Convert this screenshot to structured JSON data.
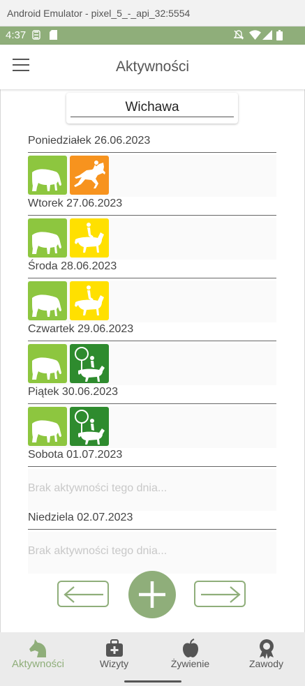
{
  "window": {
    "title": "Android Emulator - pixel_5_-_api_32:5554"
  },
  "status_bar": {
    "time": "4:37"
  },
  "app_bar": {
    "title": "Aktywności"
  },
  "horse_selector": {
    "value": "Wichawa"
  },
  "colors": {
    "accent": "#8fae7a",
    "light_green": "#8dc63f",
    "orange": "#f7931e",
    "yellow": "#ffe000",
    "dark_green": "#2e8b2e"
  },
  "days": [
    {
      "label": "Poniedziałek 26.06.2023",
      "activities": [
        {
          "icon": "grazing-horse-icon",
          "color": "light_green"
        },
        {
          "icon": "jumping-horse-icon",
          "color": "orange"
        }
      ]
    },
    {
      "label": "Wtorek 27.06.2023",
      "activities": [
        {
          "icon": "grazing-horse-icon",
          "color": "light_green"
        },
        {
          "icon": "riding-horse-icon",
          "color": "yellow"
        }
      ]
    },
    {
      "label": "Środa 28.06.2023",
      "activities": [
        {
          "icon": "grazing-horse-icon",
          "color": "light_green"
        },
        {
          "icon": "riding-horse-icon",
          "color": "yellow"
        }
      ]
    },
    {
      "label": "Czwartek 29.06.2023",
      "activities": [
        {
          "icon": "grazing-horse-icon",
          "color": "light_green"
        },
        {
          "icon": "trail-riding-icon",
          "color": "dark_green"
        }
      ]
    },
    {
      "label": "Piątek 30.06.2023",
      "activities": [
        {
          "icon": "grazing-horse-icon",
          "color": "light_green"
        },
        {
          "icon": "trail-riding-icon",
          "color": "dark_green"
        }
      ]
    },
    {
      "label": "Sobota 01.07.2023",
      "activities": [],
      "empty_text": "Brak aktywności tego dnia..."
    },
    {
      "label": "Niedziela 02.07.2023",
      "activities": [],
      "empty_text": "Brak aktywności tego dnia..."
    }
  ],
  "bottom_nav": [
    {
      "label": "Aktywności",
      "icon": "horse-head-icon",
      "active": true
    },
    {
      "label": "Wizyty",
      "icon": "medical-bag-icon",
      "active": false
    },
    {
      "label": "Żywienie",
      "icon": "apple-icon",
      "active": false
    },
    {
      "label": "Zawody",
      "icon": "award-icon",
      "active": false
    }
  ]
}
